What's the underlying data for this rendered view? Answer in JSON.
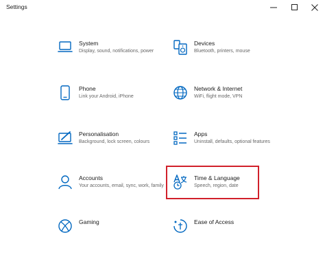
{
  "window": {
    "title": "Settings"
  },
  "tiles": [
    {
      "name": "System",
      "desc": "Display, sound, notifications, power",
      "icon": "laptop-icon"
    },
    {
      "name": "Devices",
      "desc": "Bluetooth, printers, mouse",
      "icon": "devices-icon"
    },
    {
      "name": "Phone",
      "desc": "Link your Android, iPhone",
      "icon": "phone-icon"
    },
    {
      "name": "Network & Internet",
      "desc": "WiFi, flight mode, VPN",
      "icon": "globe-icon"
    },
    {
      "name": "Personalisation",
      "desc": "Background, lock screen, colours",
      "icon": "paint-icon"
    },
    {
      "name": "Apps",
      "desc": "Uninstall, defaults, optional features",
      "icon": "apps-icon"
    },
    {
      "name": "Accounts",
      "desc": "Your accounts, email, sync, work, family",
      "icon": "person-icon"
    },
    {
      "name": "Time & Language",
      "desc": "Speech, region, date",
      "icon": "time-language-icon"
    },
    {
      "name": "Gaming",
      "desc": "",
      "icon": "xbox-icon"
    },
    {
      "name": "Ease of Access",
      "desc": "",
      "icon": "ease-of-access-icon"
    }
  ],
  "colors": {
    "accent": "#0067c0",
    "highlight": "#d1202a"
  }
}
